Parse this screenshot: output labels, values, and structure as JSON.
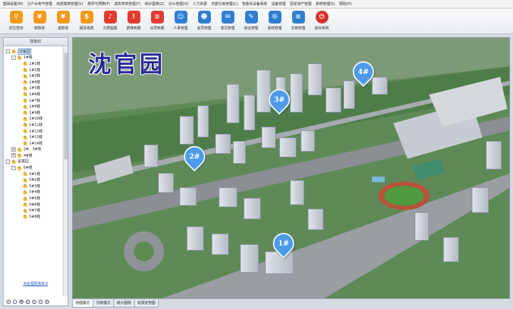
{
  "menubar": {
    "items": [
      "基础设置(M)",
      "分户水电气管理",
      "收费报表管理(V)",
      "费项与预算(F)",
      "成本表单管理(T)",
      "统计图表(Z)",
      "办公管理(O)",
      "人力资源",
      "内部仓库管理(C)",
      "智能化设备系统",
      "设备管理",
      "固定资产管理",
      "系统管理(S)",
      "帮助(H)"
    ]
  },
  "toolbar": {
    "items": [
      {
        "label": "定位查询",
        "icon": "location-search-icon",
        "glyph": "⚲",
        "color": "orange"
      },
      {
        "label": "收款单",
        "icon": "receipt-icon",
        "glyph": "¥",
        "color": "orange"
      },
      {
        "label": "退款单",
        "icon": "refund-icon",
        "glyph": "¥",
        "color": "orange"
      },
      {
        "label": "租赁收费",
        "icon": "lease-fee-icon",
        "glyph": "$",
        "color": "orange"
      },
      {
        "label": "欠费提醒",
        "icon": "bell-icon",
        "glyph": "♪",
        "color": "red"
      },
      {
        "label": "费用到期",
        "icon": "expiry-icon",
        "glyph": "!",
        "color": "red"
      },
      {
        "label": "合同到期",
        "icon": "contract-icon",
        "glyph": "≡",
        "color": "red"
      },
      {
        "label": "人事管理",
        "icon": "staff-icon",
        "glyph": "☺",
        "color": "blue"
      },
      {
        "label": "会员管理",
        "icon": "member-icon",
        "glyph": "☻",
        "color": "blue"
      },
      {
        "label": "意见管理",
        "icon": "feedback-icon",
        "glyph": "✉",
        "color": "blue"
      },
      {
        "label": "综合管理",
        "icon": "message-icon",
        "glyph": "✎",
        "color": "blue"
      },
      {
        "label": "系统管理",
        "icon": "gear-icon",
        "glyph": "⚙",
        "color": "blue"
      },
      {
        "label": "文档管理",
        "icon": "document-icon",
        "glyph": "≡",
        "color": "blue"
      },
      {
        "label": "退出系统",
        "icon": "power-icon",
        "glyph": "⏻",
        "color": "redc"
      }
    ]
  },
  "navigator": {
    "title": "导航栏",
    "tree": [
      {
        "label": "沈官园",
        "level": 0,
        "expander": "-",
        "selected": true
      },
      {
        "label": "1#楼",
        "level": 1,
        "expander": "-"
      },
      {
        "label": "1#1楼",
        "level": 2
      },
      {
        "label": "1#2楼",
        "level": 2
      },
      {
        "label": "1#3楼",
        "level": 2
      },
      {
        "label": "1#4楼",
        "level": 2
      },
      {
        "label": "1#5楼",
        "level": 2
      },
      {
        "label": "1#6楼",
        "level": 2
      },
      {
        "label": "1#7楼",
        "level": 2
      },
      {
        "label": "1#8楼",
        "level": 2
      },
      {
        "label": "1#9楼",
        "level": 2
      },
      {
        "label": "1#10楼",
        "level": 2
      },
      {
        "label": "1#11楼",
        "level": 2
      },
      {
        "label": "1#12楼",
        "level": 2
      },
      {
        "label": "1#13楼",
        "level": 2
      },
      {
        "label": "1#14楼",
        "level": 2
      },
      {
        "label": "2#、3#楼",
        "level": 1,
        "expander": "+"
      },
      {
        "label": "4#楼",
        "level": 1,
        "expander": "+"
      },
      {
        "label": "星富园",
        "level": 0,
        "expander": "-"
      },
      {
        "label": "5#楼",
        "level": 1,
        "expander": "-"
      },
      {
        "label": "5#1楼",
        "level": 2
      },
      {
        "label": "5#2楼",
        "level": 2
      },
      {
        "label": "5#3楼",
        "level": 2
      },
      {
        "label": "5#4楼",
        "level": 2
      },
      {
        "label": "5#5楼",
        "level": 2
      },
      {
        "label": "5#6楼",
        "level": 2
      },
      {
        "label": "5#7楼",
        "level": 2
      },
      {
        "label": "5#8楼",
        "level": 2
      }
    ],
    "uncheck_link": "未处理报修单:0"
  },
  "map": {
    "title": "沈官园",
    "pins": [
      "1#",
      "2#",
      "3#",
      "4#"
    ]
  },
  "tabs": [
    "地图模式",
    "列表模式",
    "统计图例",
    "收费走势图"
  ]
}
